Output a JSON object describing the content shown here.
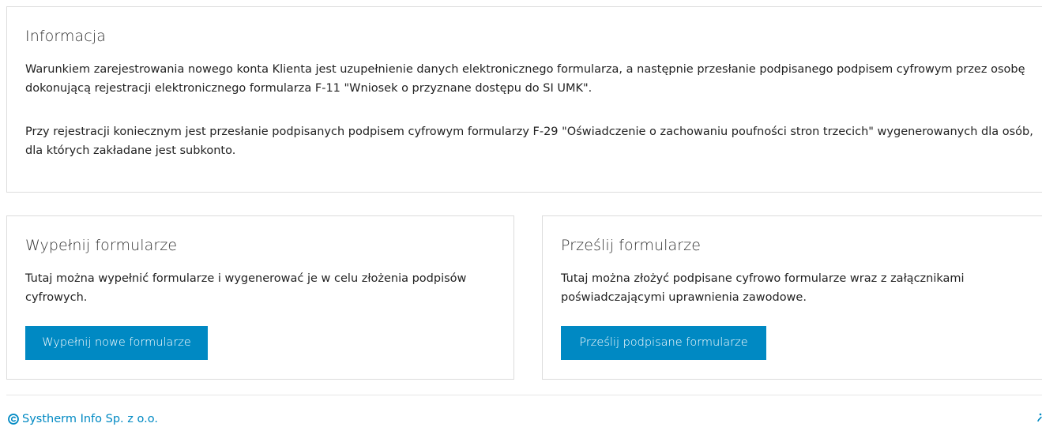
{
  "info": {
    "title": "Informacja",
    "paragraph1": "Warunkiem zarejestrowania nowego konta Klienta jest uzupełnienie danych elektronicznego formularza, a następnie przesłanie podpisanego podpisem cyfrowym przez osobę dokonującą rejestracji elektronicznego formularza F-11 \"Wniosek o przyznane dostępu do SI UMK\".",
    "paragraph2": "Przy rejestracji koniecznym jest przesłanie podpisanych podpisem cyfrowym formularzy F-29 \"Oświadczenie o zachowaniu poufności stron trzecich\" wygenerowanych dla osób, dla których zakładane jest subkonto."
  },
  "fill_forms": {
    "title": "Wypełnij formularze",
    "description": "Tutaj można wypełnić formularze i wygenerować je w celu złożenia podpisów cyfrowych.",
    "button_label": "Wypełnij nowe formularze"
  },
  "send_forms": {
    "title": "Prześlij formularze",
    "description": "Tutaj można złożyć podpisane cyfrowo formularze wraz z załącznikami poświadczającymi uprawnienia zawodowe.",
    "button_label": "Prześlij podpisane formularze"
  },
  "footer": {
    "copyright_text": "Systherm Info Sp. z o.o.",
    "copyright_icon": "copyright-icon",
    "edge_icon": "info-icon"
  },
  "colors": {
    "accent": "#0089c3",
    "border": "#dcdcdc",
    "text": "#222222"
  }
}
